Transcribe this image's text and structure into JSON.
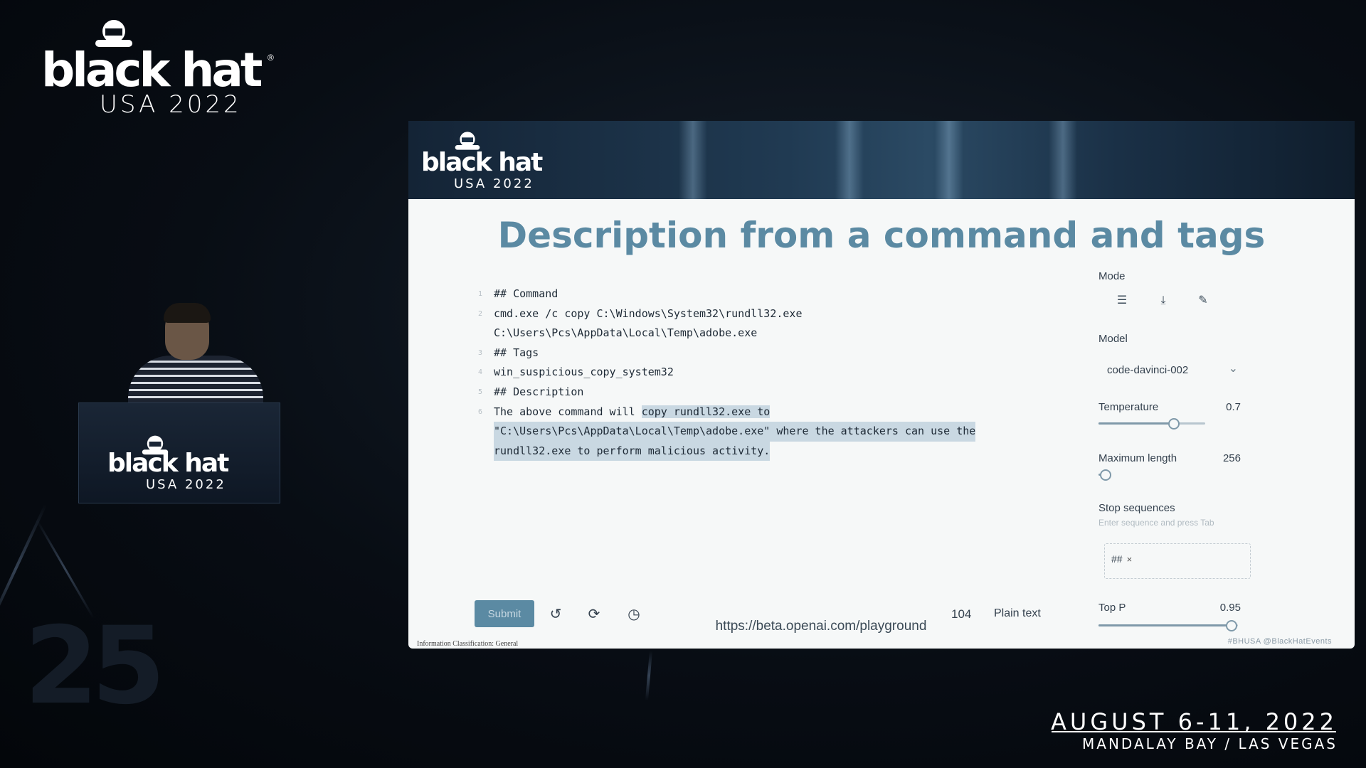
{
  "conference": {
    "wordmark": "black hat",
    "edition": "USA 2022",
    "dates": "AUGUST 6-11, 2022",
    "venue": "MANDALAY BAY / LAS VEGAS",
    "background_number": "25"
  },
  "slide": {
    "title": "Description from a command and tags",
    "url": "https://beta.openai.com/playground",
    "classification": "Information Classification: General",
    "handles": "#BHUSA   @BlackHatEvents"
  },
  "editor": {
    "lines": [
      {
        "num": "1",
        "text": "## Command"
      },
      {
        "num": "2",
        "text": "cmd.exe /c copy C:\\Windows\\System32\\rundll32.exe"
      },
      {
        "num": "",
        "text": "C:\\Users\\Pcs\\AppData\\Local\\Temp\\adobe.exe"
      },
      {
        "num": "3",
        "text": "## Tags"
      },
      {
        "num": "4",
        "text": "win_suspicious_copy_system32"
      },
      {
        "num": "5",
        "text": "## Description"
      }
    ],
    "desc_line1_plain": "The above command will ",
    "desc_line1_hl": "copy rundll32.exe to ",
    "desc_line2_hl": "\"C:\\Users\\Pcs\\AppData\\Local\\Temp\\adobe.exe\" where the attackers can use the ",
    "desc_line3_hl": "rundll32.exe to perform malicious activity.",
    "desc_line_num": "6"
  },
  "toolbar": {
    "submit_label": "Submit",
    "token_count": "104",
    "format_label": "Plain text"
  },
  "panel": {
    "mode_label": "Mode",
    "model_label": "Model",
    "model_value": "code-davinci-002",
    "temperature_label": "Temperature",
    "temperature_value": "0.7",
    "temperature_fraction": 0.7,
    "max_length_label": "Maximum length",
    "max_length_value": "256",
    "max_length_fraction": 0.06,
    "stop_label": "Stop sequences",
    "stop_placeholder": "Enter sequence and press Tab",
    "stop_chip": "##",
    "top_p_label": "Top P",
    "top_p_value": "0.95",
    "top_p_fraction": 0.95
  },
  "icons": [
    "mode-complete-icon",
    "mode-insert-icon",
    "mode-edit-icon",
    "undo-icon",
    "regenerate-icon",
    "history-icon",
    "chevron-down-icon",
    "remove-chip-icon"
  ],
  "colors": {
    "accent": "#5b8aa3",
    "highlight": "#c9d8e2",
    "slide_bg": "#f6f8f8"
  }
}
